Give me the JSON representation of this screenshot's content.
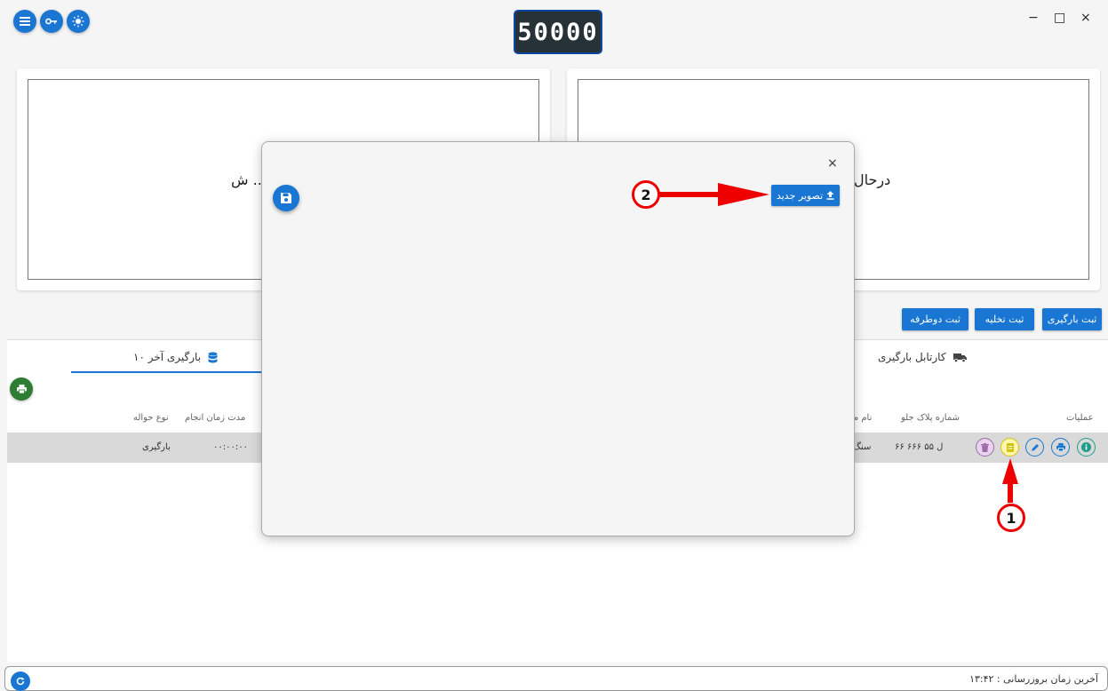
{
  "topbar": {
    "scale_value": "50000",
    "buttons": [
      "menu-icon",
      "key-icon",
      "brightness-icon"
    ],
    "window_controls": {
      "minimize": "−",
      "maximize": "□",
      "close": "×"
    }
  },
  "panels": {
    "left_text": "ش ...",
    "right_text": "درحال"
  },
  "actions": {
    "loading": "ثبت بارگیری",
    "unloading": "ثبت تخلیه",
    "two_way": "ثبت دوطرفه"
  },
  "tabs": {
    "cartable": "کارتابل بارگیری",
    "last_loadings": "۱۰ بارگیری آخر"
  },
  "table": {
    "headers": {
      "operations": "عملیات",
      "front_plate": "شماره پلاک جلو",
      "name_partial": "نام م",
      "duration": "مدت زمان انجام",
      "order_type": "نوع حواله"
    },
    "row": {
      "front_plate": "۶۶ ۶۶۶ ل ۵۵",
      "name_partial": "سنگ",
      "duration": "۰۰:۰۰:۰۰",
      "order_type": "بارگیری"
    }
  },
  "modal": {
    "close": "×",
    "upload_label": "تصویر جدید",
    "upload_icon": "upload-icon",
    "save_icon": "save-icon"
  },
  "annotations": {
    "marker_1": "1",
    "marker_2": "2"
  },
  "footer": {
    "last_update": "آخرین زمان بروزرسانی : ۱۳:۴۲"
  },
  "colors": {
    "primary": "#1976d2",
    "success": "#2e7d32",
    "annotation": "#e00000"
  }
}
